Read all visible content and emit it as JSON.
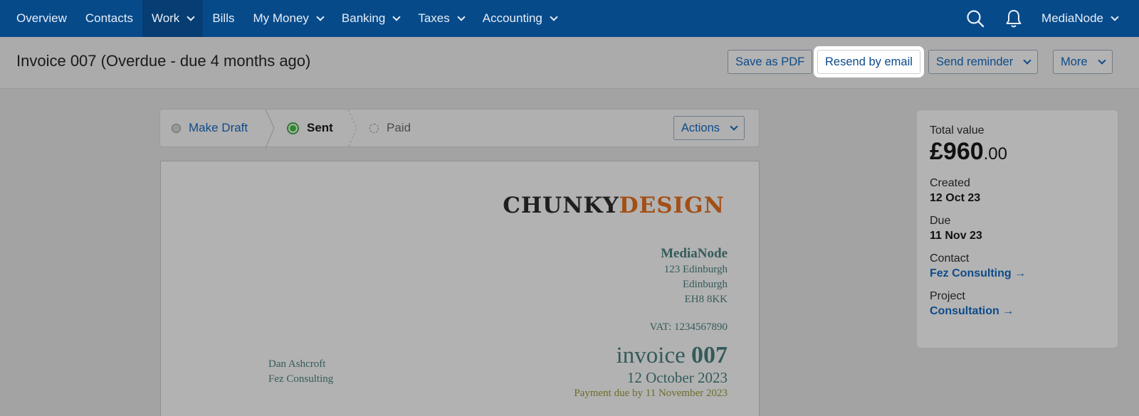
{
  "nav": {
    "items": [
      {
        "label": "Overview"
      },
      {
        "label": "Contacts"
      },
      {
        "label": "Work"
      },
      {
        "label": "Bills"
      },
      {
        "label": "My Money"
      },
      {
        "label": "Banking"
      },
      {
        "label": "Taxes"
      },
      {
        "label": "Accounting"
      }
    ],
    "account": "MediaNode"
  },
  "header": {
    "title": "Invoice 007 (Overdue - due 4 months ago)",
    "buttons": {
      "save_pdf": "Save as PDF",
      "resend": "Resend by email",
      "reminder": "Send reminder",
      "more": "More"
    }
  },
  "stepper": {
    "steps": [
      "Make Draft",
      "Sent",
      "Paid"
    ],
    "actions": "Actions"
  },
  "invoice": {
    "logo_part1": "CHUNKY",
    "logo_part2": "DESIGN",
    "company": "MediaNode",
    "address": [
      "123 Edinburgh",
      "Edinburgh",
      "EH8 8KK"
    ],
    "vat": "VAT: 1234567890",
    "client": [
      "Dan Ashcroft",
      "Fez Consulting"
    ],
    "title_word": "invoice",
    "number": "007",
    "date": "12 October 2023",
    "payment_due": "Payment due by 11 November 2023"
  },
  "summary": {
    "total_label": "Total value",
    "total_main": "£960",
    "total_cents": ".00",
    "created_label": "Created",
    "created": "12 Oct 23",
    "due_label": "Due",
    "due": "11 Nov 23",
    "contact_label": "Contact",
    "contact": "Fez Consulting →",
    "project_label": "Project",
    "project": "Consultation →"
  },
  "colors": {
    "nav_bg": "#074a8a",
    "link": "#0d4b8a",
    "sent_green": "#2d8a2d",
    "logo_accent": "#a34f16"
  }
}
